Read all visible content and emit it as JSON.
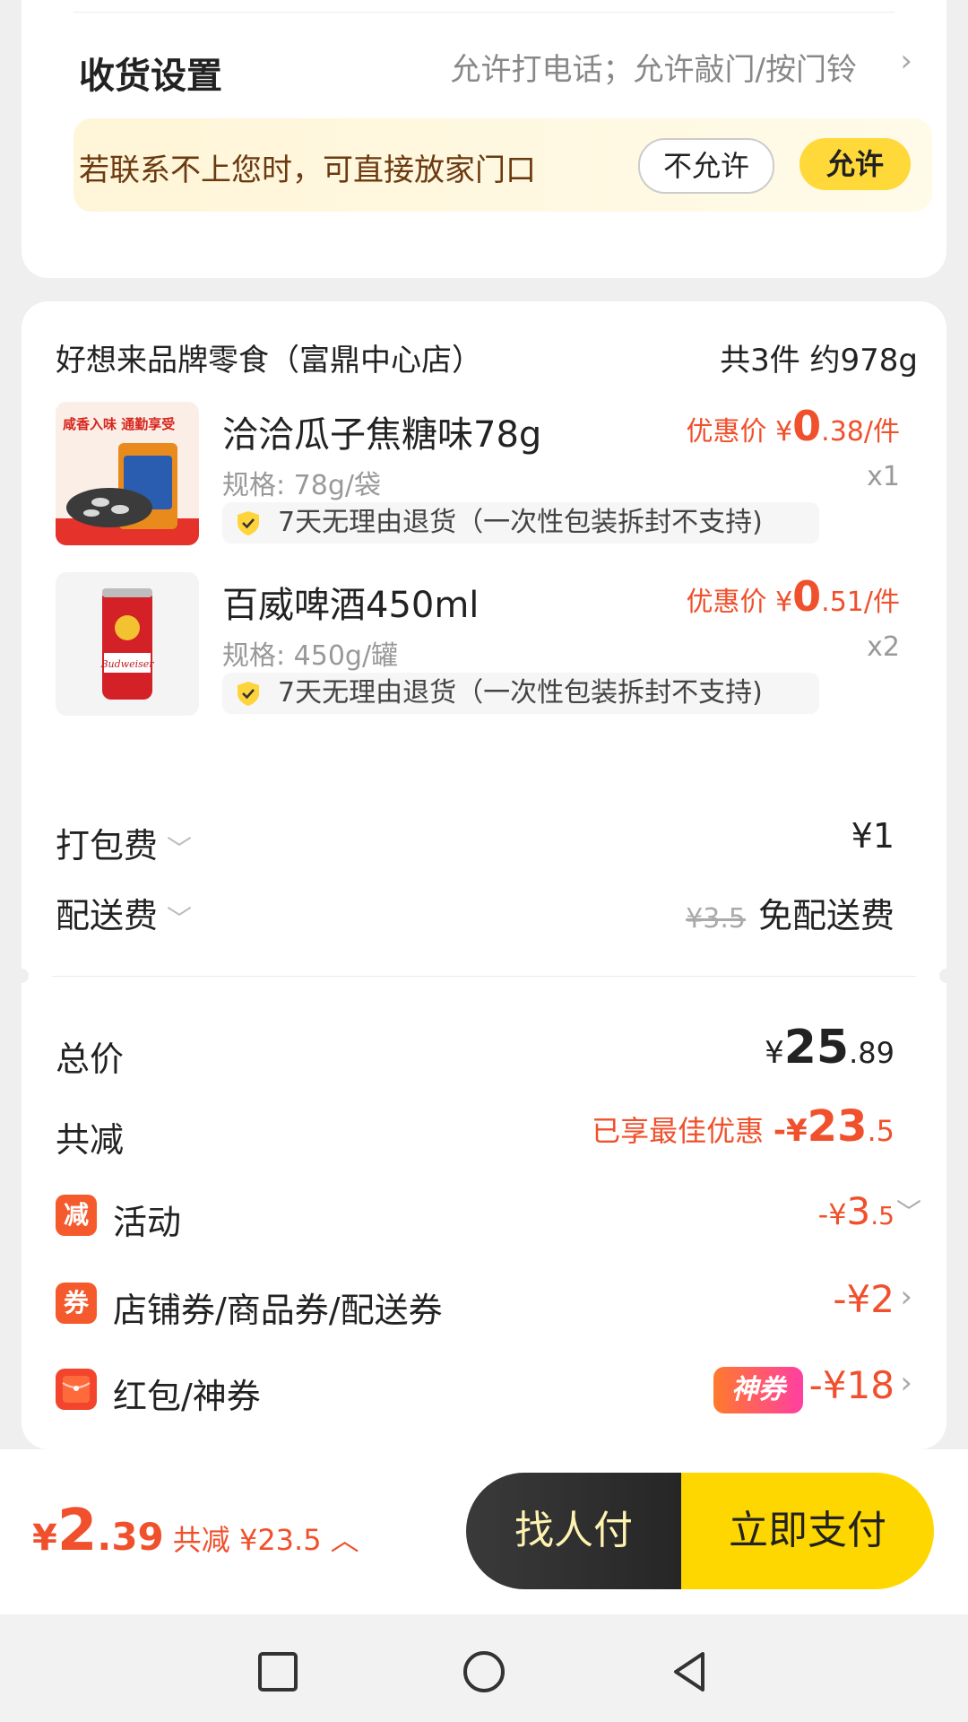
{
  "delivery_settings": {
    "title": "收货设置",
    "value": "允许打电话；允许敲门/按门铃",
    "notice": "若联系不上您时，可直接放家门口",
    "deny_label": "不允许",
    "allow_label": "允许"
  },
  "shop": {
    "name": "好想来品牌零食（富鼎中心店）",
    "summary": "共3件 约978g"
  },
  "items": [
    {
      "name": "洽洽瓜子焦糖味78g",
      "spec": "规格: 78g/袋",
      "price_label": "优惠价",
      "yen": "¥",
      "price_int": "0",
      "price_dec": ".38/件",
      "qty": "x1",
      "guarantee": "7天无理由退货（一次性包装拆封不支持)",
      "thumb_text": "咸香入味 通勤享受"
    },
    {
      "name": "百威啤酒450ml",
      "spec": "规格: 450g/罐",
      "price_label": "优惠价",
      "yen": "¥",
      "price_int": "0",
      "price_dec": ".51/件",
      "qty": "x2",
      "guarantee": "7天无理由退货（一次性包装拆封不支持)",
      "thumb_text": "Budweiser"
    }
  ],
  "fees": {
    "packing_label": "打包费",
    "packing_value": "¥1",
    "delivery_label": "配送费",
    "delivery_original": "¥3.5",
    "delivery_value": "免配送费"
  },
  "summary": {
    "total_label": "总价",
    "total_yen": "¥",
    "total_int": "25",
    "total_dec": ".89",
    "discount_label": "共减",
    "discount_note": "已享最佳优惠",
    "discount_prefix": "-¥",
    "discount_int": "23",
    "discount_dec": ".5",
    "activity_icon": "减",
    "activity_label": "活动",
    "activity_prefix": "-¥",
    "activity_int": "3",
    "activity_dec": ".5",
    "coupon_icon": "券",
    "coupon_label": "店铺券/商品券/配送券",
    "coupon_value": "-¥2",
    "redpacket_label": "红包/神券",
    "redpacket_badge": "神券",
    "redpacket_value": "-¥18"
  },
  "bottom_bar": {
    "yen": "¥",
    "price_int": "2",
    "price_dec": ".39",
    "saved": "共减 ¥23.5",
    "friend_pay": "找人付",
    "pay_now": "立即支付"
  },
  "colors": {
    "accent_red": "#f0502c",
    "pay_yellow": "#ffd700",
    "dark_button": "#2e2e2e"
  }
}
